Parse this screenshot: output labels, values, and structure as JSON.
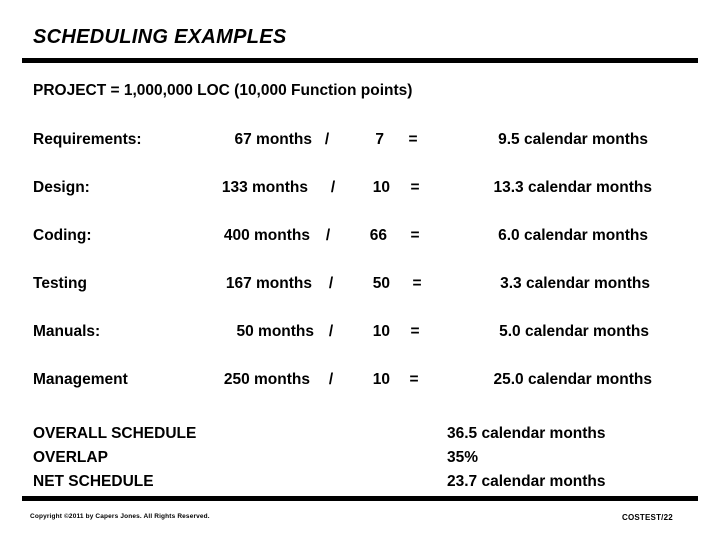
{
  "slide": {
    "title": "SCHEDULING EXAMPLES",
    "project_line": "PROJECT = 1,000,000  LOC (10,000 Function points)"
  },
  "rows": [
    {
      "label": "Requirements:",
      "effort": "67 months",
      "slash": "/",
      "staff": "7",
      "equals": "=",
      "result": "9.5 calendar months"
    },
    {
      "label": "Design:",
      "effort": "133 months",
      "slash": "/",
      "staff": "10",
      "equals": "=",
      "result": "13.3 calendar months"
    },
    {
      "label": "Coding:",
      "effort": "400 months",
      "slash": "/",
      "staff": "66",
      "equals": "=",
      "result": "6.0 calendar months"
    },
    {
      "label": "Testing",
      "effort": "167 months",
      "slash": "/",
      "staff": "50",
      "equals": "=",
      "result": "3.3 calendar months"
    },
    {
      "label": "Manuals:",
      "effort": "50 months",
      "slash": "/",
      "staff": "10",
      "equals": "=",
      "result": "5.0 calendar months"
    },
    {
      "label": "Management",
      "effort": "250 months",
      "slash": "/",
      "staff": "10",
      "equals": "=",
      "result": "25.0 calendar months"
    }
  ],
  "summary": [
    {
      "label": "OVERALL SCHEDULE",
      "value": "36.5 calendar months"
    },
    {
      "label": "OVERLAP",
      "value": "35%"
    },
    {
      "label": "NET SCHEDULE",
      "value": "23.7 calendar months"
    }
  ],
  "footer": {
    "copyright": "Copyright ©2011 by Capers Jones.  All Rights Reserved.",
    "slide_id": "COSTEST/22"
  }
}
